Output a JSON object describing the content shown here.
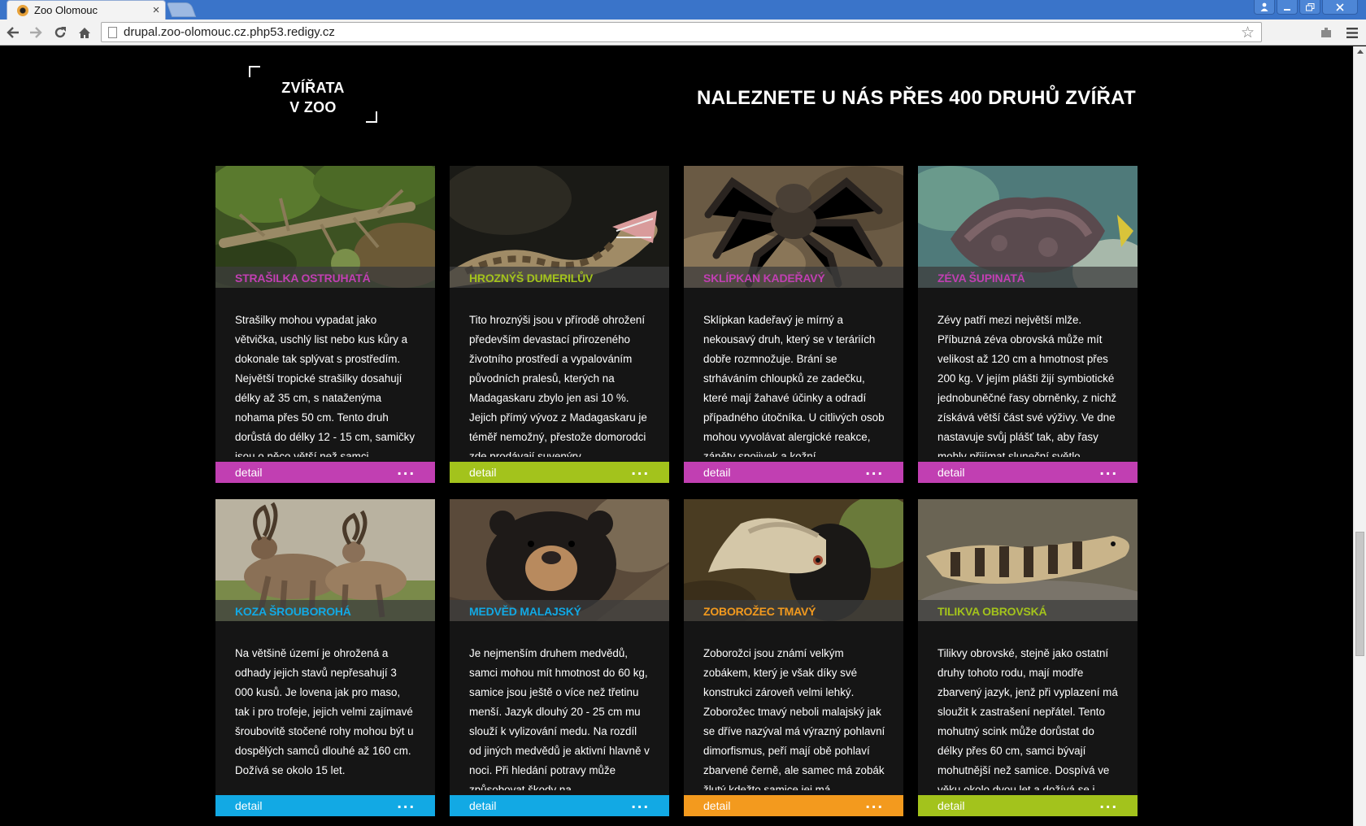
{
  "browser": {
    "tab_title": "Zoo Olomouc",
    "tab_close": "×",
    "url": "drupal.zoo-olomouc.cz.php53.redigy.cz",
    "icons": [
      "back-icon",
      "forward-icon",
      "reload-icon",
      "home-icon",
      "page-icon",
      "star-icon",
      "extension-icon",
      "menu-icon"
    ]
  },
  "section": {
    "logo_line1": "ZVÍŘATA",
    "logo_line2": "V ZOO",
    "headline": "NALEZNETE U NÁS PŘES 400 DRUHŮ ZVÍŘAT"
  },
  "colors": {
    "magenta": "#c13fb2",
    "green": "#a3c31c",
    "blue": "#12a9e4",
    "orange": "#f39a1e"
  },
  "animals": [
    {
      "name": "STRAŠILKA OSTRUHATÁ",
      "color": "#c13fb2",
      "text": "Strašilky mohou vypadat jako větvička, uschlý list nebo kus kůry a dokonale tak splývat s prostředím. Největší tropické strašilky dosahují délky až 35 cm, s nataženýma nohama přes 50 cm. Tento druh dorůstá do délky 12 - 15 cm, samičky jsou o něco větší než samci.",
      "detail": "detail"
    },
    {
      "name": "HROZNÝŠ DUMERILŮV",
      "color": "#a3c31c",
      "text": "Tito hroznýši jsou v přírodě ohrožení především devastací přirozeného životního prostředí a vypalováním původních pralesů, kterých na Madagaskaru zbylo jen asi 10 %. Jejich přímý vývoz z Madagaskaru je téměř nemožný, přestože domorodci zde prodávají suvenýry",
      "detail": "detail"
    },
    {
      "name": "SKLÍPKAN KADEŘAVÝ",
      "color": "#c13fb2",
      "text": "Sklípkan kadeřavý je mírný a nekousavý druh, který se v teráriích dobře rozmnožuje. Brání se strháváním chloupků ze zadečku, které mají žahavé účinky a odradí případného útočníka. U citlivých osob mohou vyvolávat alergické reakce, záněty spojivek a kožní",
      "detail": "detail"
    },
    {
      "name": "ZÉVA ŠUPINATÁ",
      "color": "#c13fb2",
      "text": "Zévy patří mezi největší mlže. Příbuzná zéva obrovská může mít velikost až 120 cm a hmotnost přes 200 kg. V jejím plášti žijí symbiotické jednobuněčné řasy obrněnky, z nichž získává větší část své výživy. Ve dne nastavuje svůj plášť tak, aby řasy mohly přijímat sluneční světlo,",
      "detail": "detail"
    },
    {
      "name": "KOZA ŠROUBOROHÁ",
      "color": "#12a9e4",
      "text": "Na většině území je ohrožená a odhady jejich stavů nepřesahují 3 000 kusů. Je lovena jak pro maso, tak i pro trofeje, jejich velmi zajímavé šroubovitě stočené rohy mohou být u dospělých samců dlouhé až 160 cm. Dožívá se okolo 15 let.",
      "detail": "detail"
    },
    {
      "name": "MEDVĚD MALAJSKÝ",
      "color": "#12a9e4",
      "text": "Je nejmenším druhem medvědů, samci mohou mít hmotnost do 60 kg, samice jsou ještě o více než třetinu menší. Jazyk dlouhý 20 - 25 cm mu slouží k vylizování medu. Na rozdíl od jiných medvědů je aktivní hlavně v noci. Při hledání potravy může způsobovat škody na",
      "detail": "detail"
    },
    {
      "name": "ZOBOROŽEC TMAVÝ",
      "color": "#f39a1e",
      "text": "Zoborožci jsou známí velkým zobákem, který je však díky své konstrukci zároveň velmi lehký. Zoborožec tmavý neboli malajský jak se dříve nazýval má výrazný pohlavní dimorfismus, peří mají obě pohlaví zbarvené černě, ale samec má zobák žlutý kdežto samice jej má",
      "detail": "detail"
    },
    {
      "name": "TILIKVA OBROVSKÁ",
      "color": "#a3c31c",
      "text": "Tilikvy obrovské, stejně jako ostatní druhy tohoto rodu, mají modře zbarvený jazyk, jenž při vyplazení má sloužit k zastrašení nepřátel. Tento mohutný scink může dorůstat do délky přes 60 cm, samci bývají mohutnější než samice. Dospívá ve věku okolo dvou let a dožívá se i",
      "detail": "detail"
    }
  ]
}
